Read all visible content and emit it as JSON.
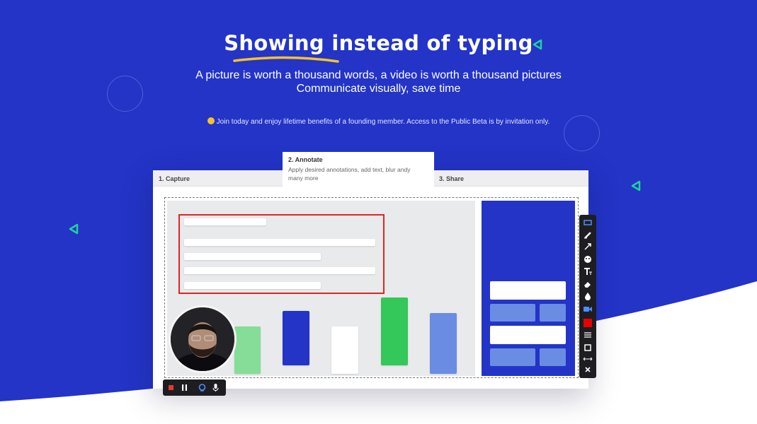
{
  "hero": {
    "title": "Showing instead of typing",
    "subtitle_line1": "A picture is worth a thousand words, a video is worth a thousand pictures",
    "subtitle_line2": "Communicate visually, save time",
    "invite": "Join today and enjoy lifetime benefits of a founding member. Access to the Public Beta is by invitation only."
  },
  "steps": {
    "capture": "1. Capture",
    "annotate_title": "2. Annotate",
    "annotate_desc": "Apply desired annotations, add text, blur andy many more",
    "share": "3. Share"
  },
  "colors": {
    "brand_blue": "#2334c7",
    "accent_green": "#1fd39a",
    "annotation_red": "#e02424",
    "underline_yellow": "#f7c325"
  },
  "annotation_toolbar": {
    "tools": [
      "rectangle-icon",
      "pen-icon",
      "arrow-icon",
      "emoji-icon",
      "text-icon",
      "eraser-icon",
      "blur-drop-icon",
      "video-icon",
      "color-swatch-red",
      "line-weight-icon",
      "square-icon",
      "resize-icon",
      "close-icon"
    ]
  },
  "recording_controls": {
    "buttons": [
      "stop-icon",
      "pause-icon",
      "webcam-icon",
      "microphone-icon"
    ]
  }
}
